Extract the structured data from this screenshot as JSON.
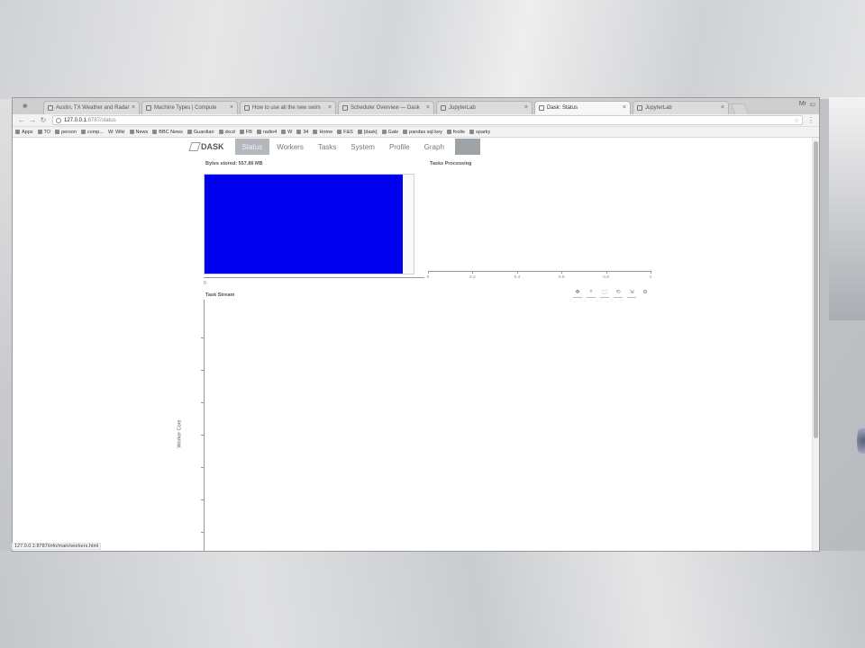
{
  "browser": {
    "tabs": [
      {
        "title": "Austin, TX Weather and Radar"
      },
      {
        "title": "Machine Types | Compute"
      },
      {
        "title": "How to use all the new swim"
      },
      {
        "title": "Scheduler Overview — Dask"
      },
      {
        "title": "JupyterLab"
      },
      {
        "title": "Dask: Status",
        "active": true
      },
      {
        "title": "JupyterLab"
      }
    ],
    "profile_label": "Mr",
    "address": {
      "host": "127.0.0.1",
      "path": ":8787/status"
    },
    "bookmarks": [
      "Apps",
      "TO",
      "person",
      "comp...",
      "W: Wiki",
      "News",
      "BBC News",
      "Guardian",
      "xkcd",
      "FB",
      "radio4",
      "W",
      "34",
      "Home",
      "F&S",
      "[dask]",
      "Gale",
      "pandas sql key",
      "foolie",
      "sparky"
    ],
    "status_url": "127.0.0.1:8787/info/main/workers.html"
  },
  "dask_nav": {
    "logo": "DASK",
    "items": [
      "Status",
      "Workers",
      "Tasks",
      "System",
      "Profile",
      "Graph"
    ],
    "active": "Status"
  },
  "bytes_plot": {
    "title": "Bytes stored: 557.86 MB",
    "x_tick": "0",
    "bar_fraction": 0.95,
    "bar_color": "#0000ee"
  },
  "processing_plot": {
    "title": "Tasks Processing",
    "ticks": [
      "0",
      "0.2",
      "0.4",
      "0.6",
      "0.8",
      "1"
    ]
  },
  "task_stream": {
    "title": "Task Stream",
    "ylabel": "Worker Core",
    "tools": [
      "pan",
      "wheel-zoom",
      "box-zoom",
      "reset",
      "save",
      "hover"
    ]
  }
}
